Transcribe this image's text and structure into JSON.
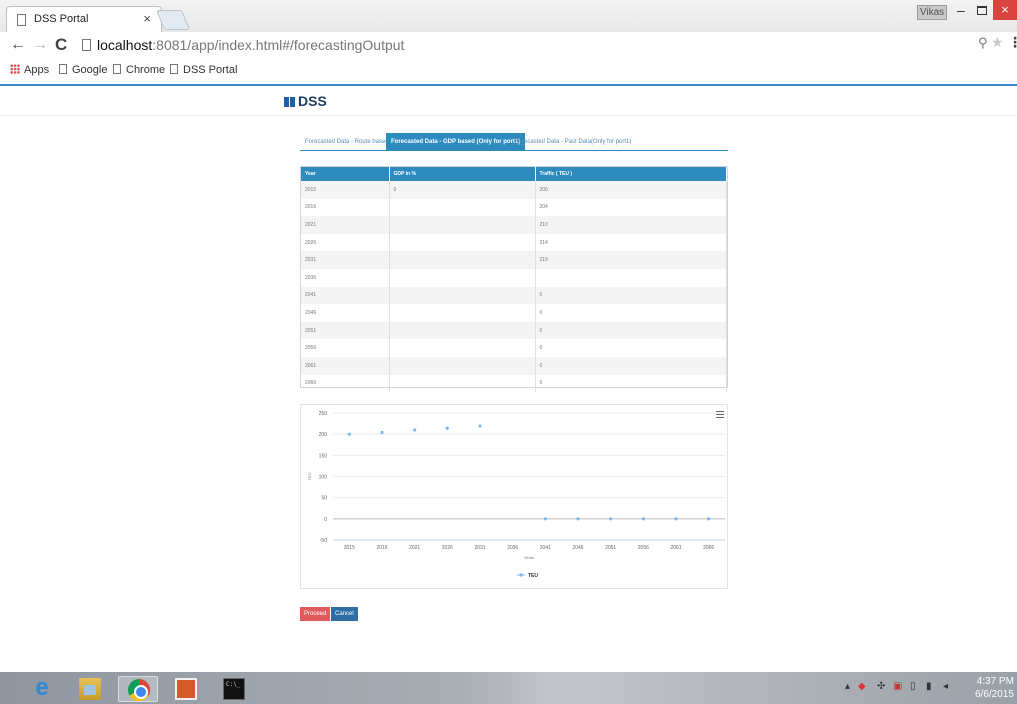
{
  "browser": {
    "tab_title": "DSS Portal",
    "tab_close": "×",
    "user_chip": "Vikas",
    "url_host": "localhost",
    "url_rest": ":8081/app/index.html#/forecastingOutput",
    "bookmarks": [
      "Apps",
      "Google",
      "Chrome",
      "DSS Portal"
    ]
  },
  "page": {
    "brand": "DSS",
    "tabs": [
      "Forecasted Data - Route based",
      "Forecasted Data - GDP based (Only for port1)",
      "Forecasted Data - Past Data(Only for port1)"
    ],
    "active_tab": 1,
    "table": {
      "headers": [
        "Year",
        "GDP in %",
        "Traffic ( TEU )"
      ],
      "rows": [
        [
          "2015",
          "0",
          "200"
        ],
        [
          "2016",
          "",
          "204"
        ],
        [
          "2021",
          "",
          "210"
        ],
        [
          "2026",
          "",
          "214"
        ],
        [
          "2031",
          "",
          "219"
        ],
        [
          "2036",
          "",
          ""
        ],
        [
          "2041",
          "",
          "0"
        ],
        [
          "2046",
          "",
          "0"
        ],
        [
          "2051",
          "",
          "0"
        ],
        [
          "2056",
          "",
          "0"
        ],
        [
          "2061",
          "",
          "0"
        ],
        [
          "2066",
          "",
          "0"
        ]
      ]
    },
    "buttons": {
      "proceed": "Proceed",
      "cancel": "Cancel"
    }
  },
  "chart_data": {
    "type": "line",
    "categories": [
      "2015",
      "2016",
      "2021",
      "2026",
      "2031",
      "2036",
      "2041",
      "2046",
      "2051",
      "2056",
      "2061",
      "2066"
    ],
    "series": [
      {
        "name": "TEU",
        "values": [
          200,
          204,
          210,
          214,
          219,
          null,
          0,
          0,
          0,
          0,
          0,
          0
        ],
        "color": "#7cb5ec"
      }
    ],
    "xlabel": "Years",
    "ylabel": "TEU",
    "yticks": [
      250,
      200,
      150,
      100,
      50,
      0,
      -50
    ],
    "ylim": [
      -50,
      250
    ],
    "grid": true,
    "legend": "bottom-center"
  },
  "taskbar": {
    "time": "4:37 PM",
    "date": "6/6/2015"
  }
}
